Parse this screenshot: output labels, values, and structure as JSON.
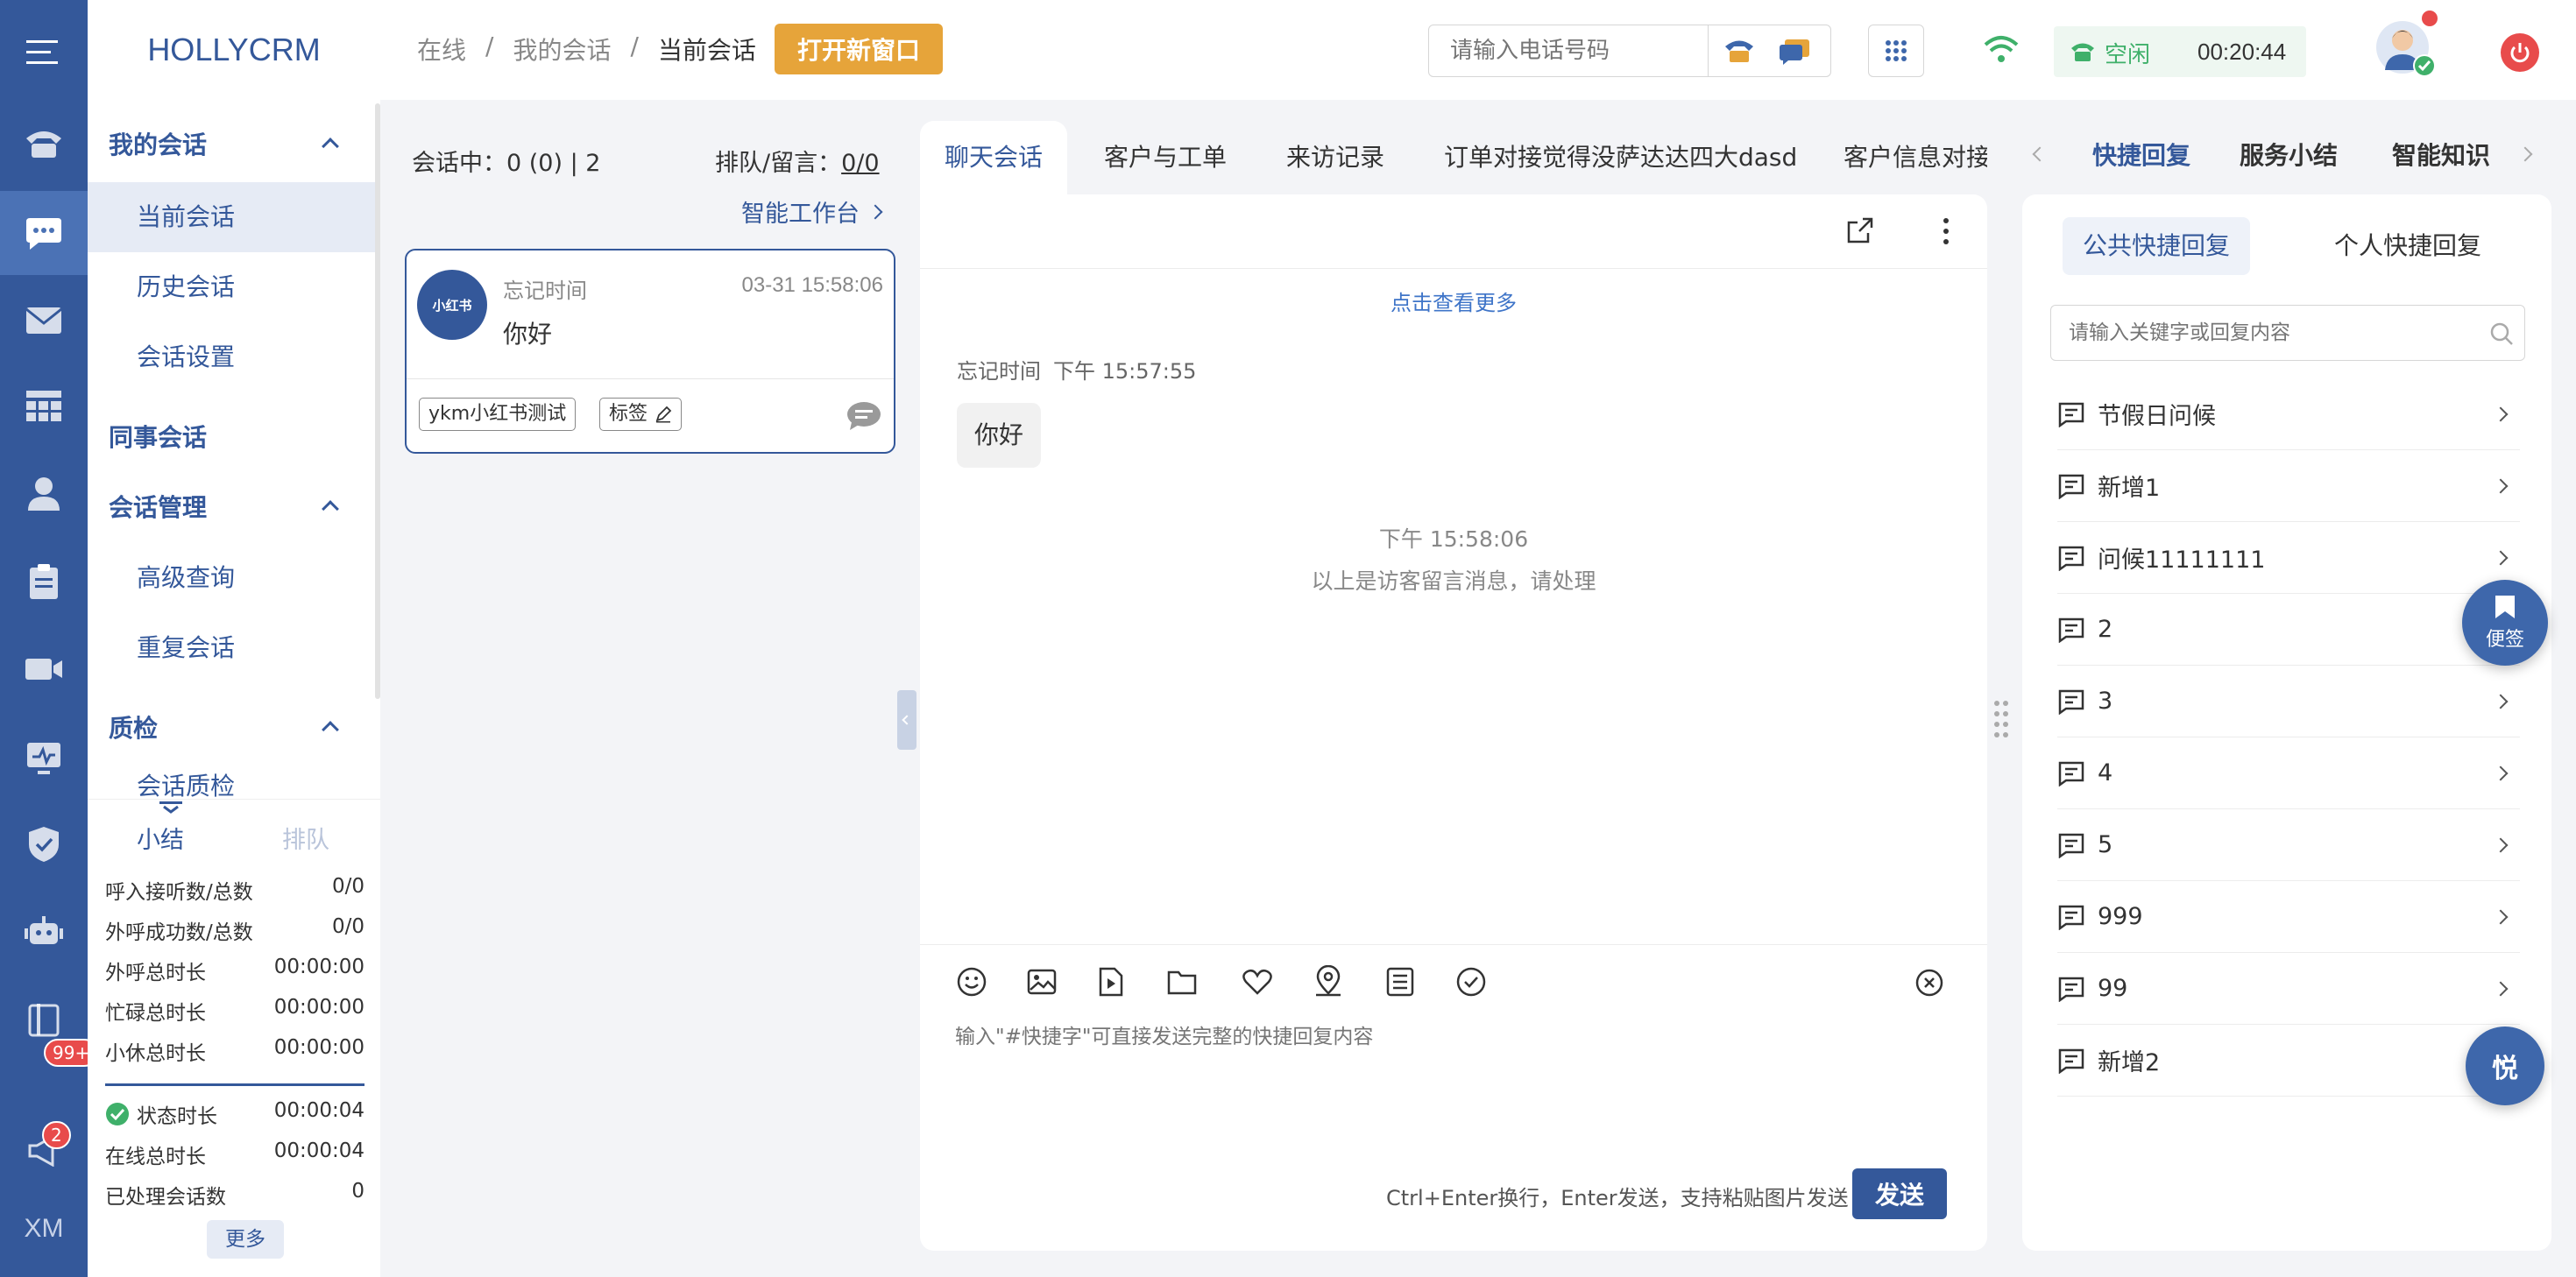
{
  "nav": {
    "logo": "HOLLYCRM",
    "groups": [
      {
        "label": "我的会话",
        "items": [
          "当前会话",
          "历史会话",
          "会话设置"
        ]
      },
      {
        "label": "同事会话",
        "items": []
      },
      {
        "label": "会话管理",
        "items": [
          "高级查询",
          "重复会话"
        ]
      },
      {
        "label": "质检",
        "items": [
          "会话质检"
        ]
      }
    ]
  },
  "rail": {
    "badge_notes": "99+",
    "badge_notice": "2",
    "footer": "XM"
  },
  "stats": {
    "tab_summary": "小结",
    "tab_queue": "排队",
    "rows": [
      {
        "label": "呼入接听数/总数",
        "value": "0/0"
      },
      {
        "label": "外呼成功数/总数",
        "value": "0/0"
      },
      {
        "label": "外呼总时长",
        "value": "00:00:00"
      },
      {
        "label": "忙碌总时长",
        "value": "00:00:00"
      },
      {
        "label": "小休总时长",
        "value": "00:00:00"
      }
    ],
    "rows2": [
      {
        "label": "状态时长",
        "value": "00:00:04"
      },
      {
        "label": "在线总时长",
        "value": "00:00:04"
      },
      {
        "label": "已处理会话数",
        "value": "0"
      }
    ],
    "more": "更多"
  },
  "header": {
    "breadcrumb": [
      "在线",
      "/",
      "我的会话",
      "/",
      "当前会话"
    ],
    "open_window": "打开新窗口",
    "phone_placeholder": "请输入电话号码",
    "status": "空闲",
    "timer": "00:20:44"
  },
  "session_list": {
    "in_session_label": "会话中：",
    "in_session_value": "0 (0) | 2",
    "queue_label": "排队/留言：",
    "queue_value": "0/0",
    "workbench": "智能工作台",
    "card": {
      "avatar": "小红书",
      "name": "忘记时间",
      "time": "03-31 15:58:06",
      "message": "你好",
      "source_tag": "ykm小红书测试",
      "tag_button": "标签"
    }
  },
  "chat": {
    "tabs": [
      "聊天会话",
      "客户与工单",
      "来访记录",
      "订单对接觉得没萨达达四大dasd",
      "客户信息对接"
    ],
    "load_more": "点击查看更多",
    "msg_sender": "忘记时间",
    "msg_time": "下午 15:57:55",
    "msg_text": "你好",
    "sys_time": "下午 15:58:06",
    "sys_text": "以上是访客留言消息，请处理",
    "input_placeholder": "输入\"#快捷字\"可直接发送完整的快捷回复内容",
    "hint": "Ctrl+Enter换行，Enter发送，支持粘贴图片发送",
    "send": "发送"
  },
  "right": {
    "tabs": [
      "快捷回复",
      "服务小结",
      "智能知识"
    ],
    "sub_public": "公共快捷回复",
    "sub_personal": "个人快捷回复",
    "search_placeholder": "请输入关键字或回复内容",
    "items": [
      "节假日问候",
      "新增1",
      "问候11111111",
      "2",
      "3",
      "4",
      "5",
      "999",
      "99",
      "新增2"
    ],
    "note_btn": "便签",
    "logo_btn": "悦"
  },
  "colors": {
    "primary": "#34589a",
    "orange": "#e6a43a",
    "green": "#3fb06a"
  }
}
